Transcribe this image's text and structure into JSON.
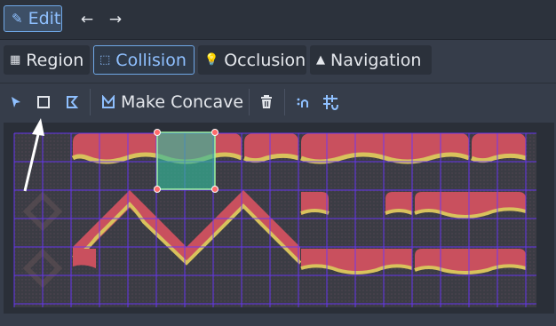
{
  "topbar": {
    "edit_label": "Edit",
    "back_icon": "arrow-left-icon",
    "forward_icon": "arrow-right-icon"
  },
  "tabs": [
    {
      "label": "Region",
      "icon": "region-icon",
      "active": false
    },
    {
      "label": "Collision",
      "icon": "collision-icon",
      "active": true
    },
    {
      "label": "Occlusion",
      "icon": "occlusion-icon",
      "active": false
    },
    {
      "label": "Navigation",
      "icon": "navigation-icon",
      "active": false
    }
  ],
  "toolbar": {
    "make_concave_label": "Make Concave",
    "tools": [
      "select-tool-icon",
      "rectangle-tool-icon",
      "polygon-tool-icon",
      "make-concave-icon",
      "delete-icon",
      "snap-icon",
      "grid-snap-icon"
    ]
  },
  "colors": {
    "accent": "#6fa7e6",
    "accent_text": "#8fc0ff",
    "grid_line": "#6a35ff",
    "tile_red": "#c9505e",
    "tile_yellow": "#d8c25c",
    "collision_fill": "#34b89a",
    "handle": "#ff6b6b",
    "background": "#363d4a"
  }
}
